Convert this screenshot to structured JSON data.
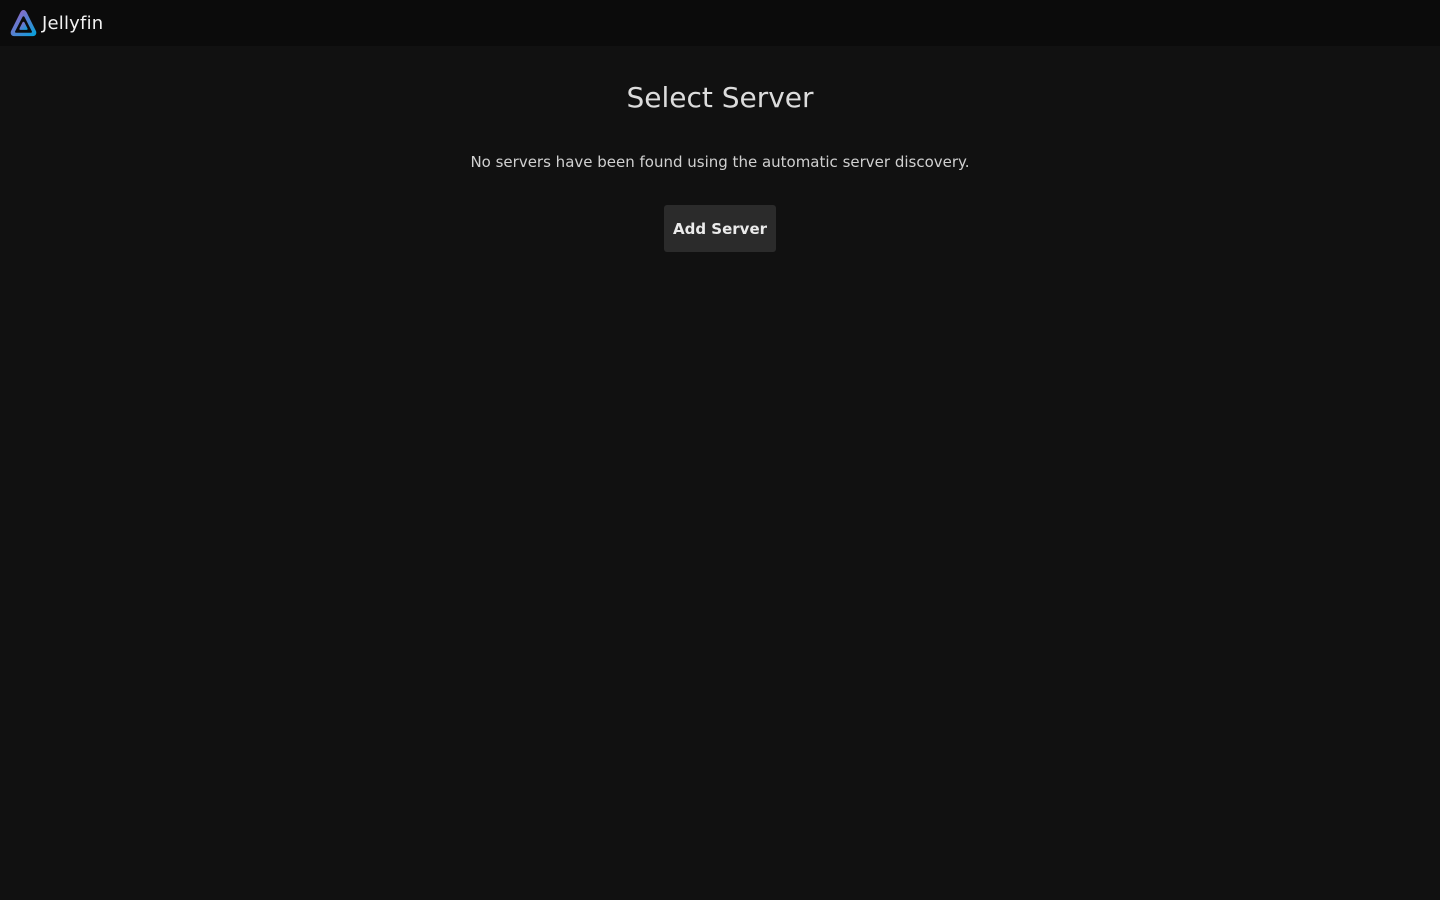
{
  "header": {
    "logo_icon": "jellyfin-logo-icon",
    "app_name": "Jellyfin"
  },
  "main": {
    "title": "Select Server",
    "message": "No servers have been found using the automatic server discovery.",
    "add_server_label": "Add Server"
  },
  "colors": {
    "background": "#111111",
    "header_background": "#0b0b0b",
    "button_background": "#2b2b2b",
    "logo_gradient_start": "#aa5cc3",
    "logo_gradient_end": "#00a4dc"
  }
}
